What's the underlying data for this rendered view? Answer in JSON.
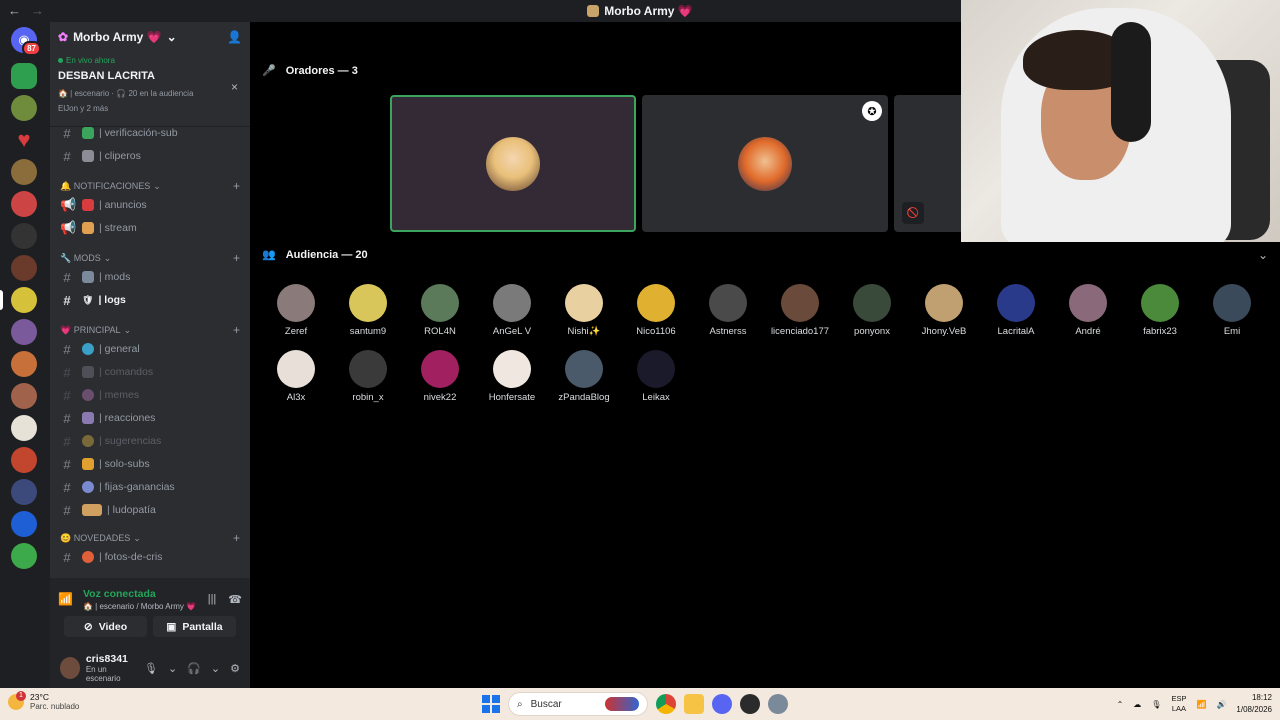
{
  "window": {
    "title": "Morbo Army 💗",
    "back": "←",
    "forward": "→"
  },
  "colors": {
    "accent_green": "#23a55a",
    "sidebar": "#2b2d31",
    "rail": "#1e1f22",
    "danger": "#f23f43"
  },
  "rail": {
    "home_badge": "87"
  },
  "server": {
    "name": "Morbo Army 💗",
    "live": {
      "status": "En vivo ahora",
      "name": "DESBAN LACRITA",
      "meta": "🏠 | escenario · 🎧 20 en la audiencia",
      "who": "ElJon y 2 más",
      "close": "×"
    },
    "channels": [
      {
        "label": "| verificación-sub",
        "state": "normal"
      },
      {
        "label": "| cliperos",
        "state": "normal"
      }
    ],
    "categories": [
      {
        "label": "🔔 NOTIFICACIONES",
        "items": [
          {
            "label": "| anuncios"
          },
          {
            "label": "| stream"
          }
        ]
      },
      {
        "label": "🔧 MODS",
        "items": [
          {
            "label": "| mods"
          },
          {
            "label": "| logs"
          }
        ]
      },
      {
        "label": "💗 PRINCIPAL",
        "items": [
          {
            "label": "| general"
          },
          {
            "label": "| comandos"
          },
          {
            "label": "| memes"
          },
          {
            "label": "| reacciones"
          },
          {
            "label": "| sugerencias"
          },
          {
            "label": "| solo-subs"
          },
          {
            "label": "| fijas-ganancias"
          },
          {
            "label": "| ludopatía"
          }
        ]
      },
      {
        "label": "😊 NOVEDADES",
        "items": [
          {
            "label": "| fotos-de-cris"
          }
        ]
      }
    ]
  },
  "voice": {
    "status": "Voz conectada",
    "location": "🏠 | escenario / Morbo Army 💗",
    "video": "Video",
    "screen": "Pantalla"
  },
  "user": {
    "name": "cris8341",
    "status": "En un escenario"
  },
  "stage": {
    "speakers_title": "Oradores — 3",
    "audience_title": "Audiencia — 20",
    "audience": [
      "Zeref",
      "santum9",
      "ROL4N",
      "AnGeL V",
      "Nishi✨",
      "Nico1106",
      "Astnerss",
      "licenciado177",
      "ponyonx",
      "Jhony.VeB",
      "LacritalA",
      "André",
      "fabrix23",
      "Emi",
      "Al3x",
      "robin_x",
      "nivek22",
      "Honfersate",
      "zPandaBlog",
      "Leikax"
    ]
  },
  "taskbar": {
    "temp": "23°C",
    "weather": "Parc. nublado",
    "weather_badge": "1",
    "search": "Buscar",
    "lang1": "ESP",
    "lang2": "LAA",
    "time": "18:12",
    "date": "1/08/2026"
  }
}
